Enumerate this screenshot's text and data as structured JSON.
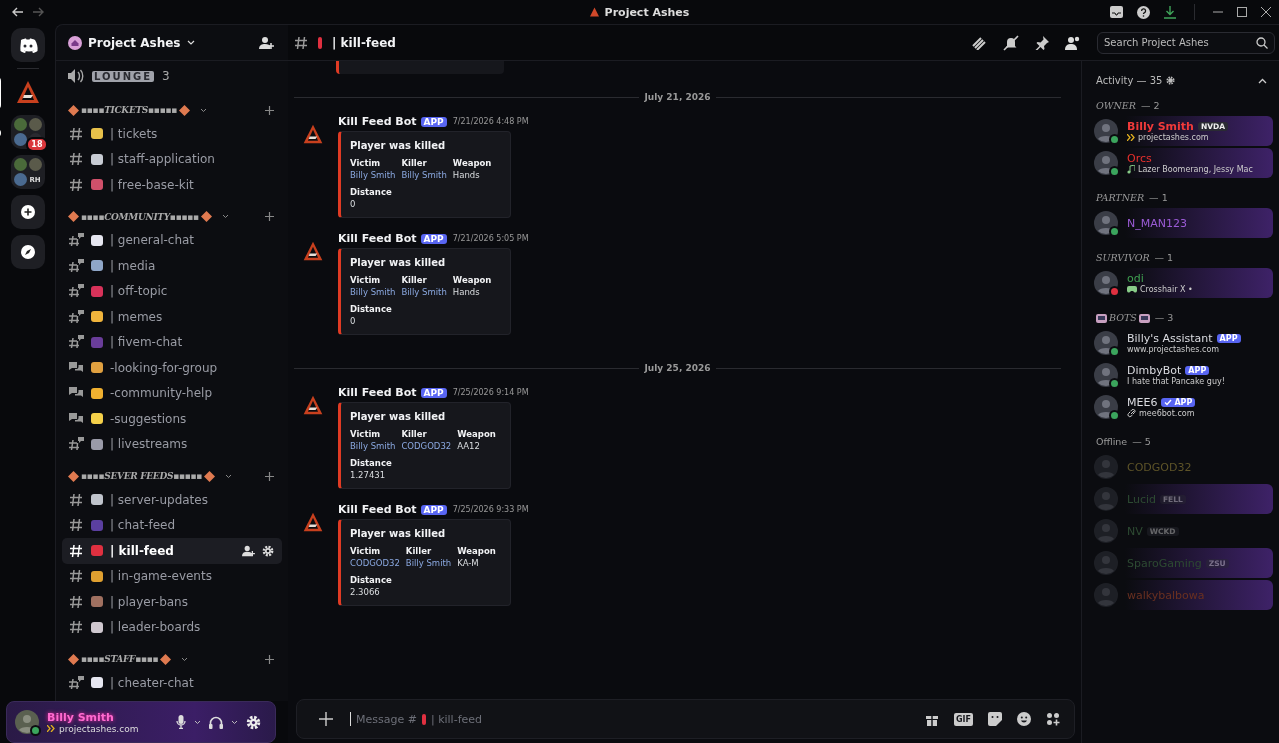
{
  "window": {
    "title": "Project Ashes"
  },
  "servers": [
    {
      "kind": "home",
      "selected": false,
      "unread": false
    },
    {
      "kind": "server",
      "selected": true,
      "unread": false
    },
    {
      "kind": "folder",
      "selected": false,
      "unread": true,
      "badge": "18"
    },
    {
      "kind": "folder",
      "selected": false,
      "unread": false,
      "initials": "RH"
    },
    {
      "kind": "add",
      "selected": false,
      "unread": false
    },
    {
      "kind": "discover",
      "selected": false,
      "unread": false
    }
  ],
  "server": {
    "name": "Project Ashes"
  },
  "voice": {
    "name": "LOUNGE",
    "count": "3"
  },
  "categories": [
    {
      "name": "▪▪▪▪TICKETS▪▪▪▪▪",
      "channels": [
        {
          "kind": "text",
          "name": "| tickets",
          "color": "#e8c14a",
          "selected": false
        },
        {
          "kind": "text",
          "name": "| staff-application",
          "color": "#c8ccd4",
          "selected": false
        },
        {
          "kind": "text",
          "name": "| free-base-kit",
          "color": "#d0506a",
          "selected": false
        }
      ]
    },
    {
      "name": "▪▪▪▪COMMUNITY▪▪▪▪▪",
      "channels": [
        {
          "kind": "thread",
          "name": "| general-chat",
          "color": "#e6e6f0",
          "selected": false
        },
        {
          "kind": "thread",
          "name": "| media",
          "color": "#8fa6c8",
          "selected": false
        },
        {
          "kind": "thread",
          "name": "| off-topic",
          "color": "#d8325a",
          "selected": false
        },
        {
          "kind": "thread",
          "name": "| memes",
          "color": "#f0b43c",
          "selected": false
        },
        {
          "kind": "thread",
          "name": "| fivem-chat",
          "color": "#6a3d9a",
          "selected": false
        },
        {
          "kind": "forum",
          "name": "-looking-for-group",
          "color": "#e0a040",
          "selected": false
        },
        {
          "kind": "forum",
          "name": "-community-help",
          "color": "#f0b030",
          "selected": false
        },
        {
          "kind": "forum",
          "name": "-suggestions",
          "color": "#f5d04a",
          "selected": false
        },
        {
          "kind": "thread",
          "name": "| livestreams",
          "color": "#9a9aa8",
          "selected": false
        }
      ]
    },
    {
      "name": "▪▪▪▪SEVER FEEDS▪▪▪▪▪",
      "channels": [
        {
          "kind": "text",
          "name": "| server-updates",
          "color": "#c0c4cc",
          "selected": false
        },
        {
          "kind": "text",
          "name": "| chat-feed",
          "color": "#5b3fa0",
          "selected": false
        },
        {
          "kind": "text",
          "name": "| kill-feed",
          "color": "#e03040",
          "selected": true
        },
        {
          "kind": "text",
          "name": "| in-game-events",
          "color": "#e0a030",
          "selected": false
        },
        {
          "kind": "text",
          "name": "| player-bans",
          "color": "#a07060",
          "selected": false
        },
        {
          "kind": "text",
          "name": "| leader-boards",
          "color": "#d0c8d0",
          "selected": false
        }
      ]
    },
    {
      "name": "▪▪▪▪STAFF▪▪▪▪",
      "channels": [
        {
          "kind": "thread",
          "name": "| cheater-chat",
          "color": "#e6e6f0",
          "selected": false
        }
      ]
    }
  ],
  "user": {
    "name": "Billy Smith",
    "status": "projectashes.com"
  },
  "channel": {
    "name": "| kill-feed",
    "search_placeholder": "Search Project Ashes"
  },
  "messages": [
    {
      "kind": "divider",
      "date": "July 21, 2026"
    },
    {
      "kind": "message",
      "author": "Kill Feed Bot",
      "tag": "APP",
      "time": "7/21/2026 4:48 PM",
      "title": "Player was killed",
      "fields": [
        {
          "name": "Victim",
          "value": "Billy Smith",
          "link": true
        },
        {
          "name": "Killer",
          "value": "Billy Smith",
          "link": true
        },
        {
          "name": "Weapon",
          "value": "Hands",
          "link": false
        }
      ],
      "distance_label": "Distance",
      "distance": "0"
    },
    {
      "kind": "message",
      "author": "Kill Feed Bot",
      "tag": "APP",
      "time": "7/21/2026 5:05 PM",
      "title": "Player was killed",
      "fields": [
        {
          "name": "Victim",
          "value": "Billy Smith",
          "link": true
        },
        {
          "name": "Killer",
          "value": "Billy Smith",
          "link": true
        },
        {
          "name": "Weapon",
          "value": "Hands",
          "link": false
        }
      ],
      "distance_label": "Distance",
      "distance": "0"
    },
    {
      "kind": "divider",
      "date": "July 25, 2026"
    },
    {
      "kind": "message",
      "author": "Kill Feed Bot",
      "tag": "APP",
      "time": "7/25/2026 9:14 PM",
      "title": "Player was killed",
      "fields": [
        {
          "name": "Victim",
          "value": "Billy Smith",
          "link": true
        },
        {
          "name": "Killer",
          "value": "CODGOD32",
          "link": true
        },
        {
          "name": "Weapon",
          "value": "AA12",
          "link": false
        }
      ],
      "distance_label": "Distance",
      "distance": "1.27431"
    },
    {
      "kind": "message",
      "author": "Kill Feed Bot",
      "tag": "APP",
      "time": "7/25/2026 9:33 PM",
      "title": "Player was killed",
      "fields": [
        {
          "name": "Victim",
          "value": "CODGOD32",
          "link": true
        },
        {
          "name": "Killer",
          "value": "Billy Smith",
          "link": true
        },
        {
          "name": "Weapon",
          "value": "KA-M",
          "link": false
        }
      ],
      "distance_label": "Distance",
      "distance": "2.3066"
    }
  ],
  "composer": {
    "placeholder_start": "Message #",
    "placeholder_end": "| kill-feed",
    "gif_label": "GIF"
  },
  "members": {
    "header": "Activity — 35",
    "groups": [
      {
        "kind": "role",
        "title": "OWNER",
        "count": "— 2",
        "members": [
          {
            "name": "Billy Smith",
            "color": "#f03a3a",
            "offline": false,
            "dnd": false,
            "activity": {
              "kind": "status",
              "text": "projectashes.com"
            },
            "guild_tag": "NVDA",
            "banner": true
          },
          {
            "name": "Orcs",
            "color": "#e8302c",
            "offline": false,
            "dnd": false,
            "activity": {
              "kind": "music",
              "text": "Lazer Boomerang, Jessy Mac"
            },
            "banner": true
          }
        ]
      },
      {
        "kind": "role",
        "title": "PARTNER",
        "count": "— 1",
        "members": [
          {
            "name": "N_MAN123",
            "color": "#9b5bd6",
            "offline": false,
            "dnd": false,
            "banner": true
          }
        ]
      },
      {
        "kind": "role",
        "title": "SURVIVOR",
        "count": "— 1",
        "members": [
          {
            "name": "odi",
            "color": "#3fa050",
            "offline": false,
            "dnd": true,
            "activity": {
              "kind": "game",
              "text": "Crosshair X •"
            },
            "banner": true
          }
        ]
      },
      {
        "kind": "role-emoji",
        "title": "BOTS",
        "count": "— 3",
        "members": [
          {
            "name": "Billy's Assistant",
            "color": "#dcdde2",
            "offline": false,
            "dnd": false,
            "activity": {
              "kind": "plain",
              "text": "www.projectashes.com"
            },
            "app_tag": "APP",
            "verified": false,
            "banner": false
          },
          {
            "name": "DimbyBot",
            "color": "#dcdde2",
            "offline": false,
            "dnd": false,
            "activity": {
              "kind": "plain",
              "text": "I hate that Pancake guy!"
            },
            "app_tag": "APP",
            "verified": false,
            "banner": false
          },
          {
            "name": "MEE6",
            "color": "#dcdde2",
            "offline": false,
            "dnd": false,
            "activity": {
              "kind": "link",
              "text": "mee6bot.com"
            },
            "app_tag": "APP",
            "verified": true,
            "banner": false
          }
        ]
      },
      {
        "kind": "offline",
        "title": "Offline",
        "count": "— 5",
        "members": [
          {
            "name": "CODGOD32",
            "color": "#5e5428",
            "offline": true,
            "banner": false
          },
          {
            "name": "Lucid",
            "color": "#2d4a32",
            "offline": true,
            "guild_tag": "FELL",
            "banner": true
          },
          {
            "name": "NV",
            "color": "#2d4a32",
            "offline": true,
            "guild_tag": "WCKD",
            "banner": false
          },
          {
            "name": "SparoGaming",
            "color": "#2d4a32",
            "offline": true,
            "guild_tag": "ZSU",
            "banner": true
          },
          {
            "name": "walkybalbowa",
            "color": "#6a3020",
            "offline": true,
            "banner": true
          }
        ]
      }
    ]
  }
}
